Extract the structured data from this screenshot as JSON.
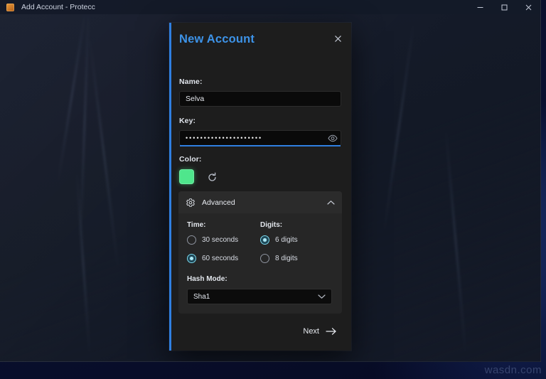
{
  "desktop": {
    "watermark": "wasdn.com"
  },
  "window": {
    "title": "Add Account - Protecc",
    "app_icon": "protecc-app-icon",
    "controls": {
      "minimize": "minimize-icon",
      "maximize": "maximize-icon",
      "close": "close-icon"
    }
  },
  "dialog": {
    "title": "New Account",
    "title_color": "#3d93e8",
    "close_icon": "close-icon",
    "name": {
      "label": "Name:",
      "value": "Selva",
      "placeholder": ""
    },
    "key": {
      "label": "Key:",
      "value": "•••••••••••••••••••••",
      "placeholder": "",
      "reveal_icon": "eye-icon",
      "focus_color": "#2f7fe0"
    },
    "color": {
      "label": "Color:",
      "swatch_color": "#4fe68c",
      "refresh_icon": "refresh-icon"
    },
    "advanced": {
      "label": "Advanced",
      "gear_icon": "gear-icon",
      "chevron_icon": "chevron-up-icon",
      "expanded": true,
      "time": {
        "label": "Time:",
        "options": [
          {
            "label": "30 seconds",
            "selected": false
          },
          {
            "label": "60 seconds",
            "selected": true
          }
        ]
      },
      "digits": {
        "label": "Digits:",
        "options": [
          {
            "label": "6 digits",
            "selected": true
          },
          {
            "label": "8 digits",
            "selected": false
          }
        ]
      },
      "hash_mode": {
        "label": "Hash Mode:",
        "value": "Sha1",
        "chevron_icon": "chevron-down-icon"
      }
    },
    "next": {
      "label": "Next",
      "arrow_icon": "arrow-right-icon"
    }
  }
}
